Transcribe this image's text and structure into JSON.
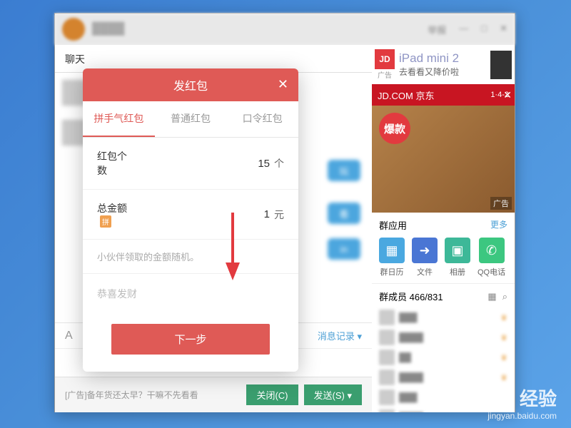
{
  "titlebar": {
    "report": "举报",
    "min": "—",
    "mid": "□",
    "close": "✕"
  },
  "chat": {
    "tab": "聊天",
    "bubbles": [
      "玩",
      "看",
      "in"
    ],
    "record_label": "消息记录",
    "record_dropdown": "▾"
  },
  "bottom": {
    "ad_text": "[广告]备年货还太早？干嘛不先看看",
    "close_btn": "关闭(C)",
    "send_btn": "发送(S)",
    "send_dropdown": "▾"
  },
  "side": {
    "jd_logo": "JD",
    "ad_label": "广告",
    "ipad_title": "iPad mini 2",
    "ipad_sub": "去看看又降价啦",
    "jd_banner": "JD.COM 京东",
    "jd_banner_extra": "1·4-2",
    "food_badge": "爆款",
    "food_ad": "广告",
    "apps_title": "群应用",
    "apps_more": "更多",
    "apps": [
      {
        "name": "群日历",
        "color": "#4aa8e0",
        "glyph": "▦"
      },
      {
        "name": "文件",
        "color": "#4a76d4",
        "glyph": "➜"
      },
      {
        "name": "相册",
        "color": "#3db898",
        "glyph": "▣"
      },
      {
        "name": "QQ电话",
        "color": "#3cc780",
        "glyph": "✆"
      }
    ],
    "members_title": "群成员 466/831"
  },
  "modal": {
    "title": "发红包",
    "tabs": [
      "拼手气红包",
      "普通红包",
      "口令红包"
    ],
    "count_label": "红包个数",
    "count_value": "15",
    "count_unit": "个",
    "amount_label": "总金额",
    "amount_badge": "拼",
    "amount_value": "1",
    "amount_unit": "元",
    "note": "小伙伴领取的金额随机。",
    "wish_placeholder": "恭喜发财",
    "submit": "下一步"
  },
  "watermark": {
    "logo": "Baidu 经验",
    "url": "jingyan.baidu.com"
  }
}
